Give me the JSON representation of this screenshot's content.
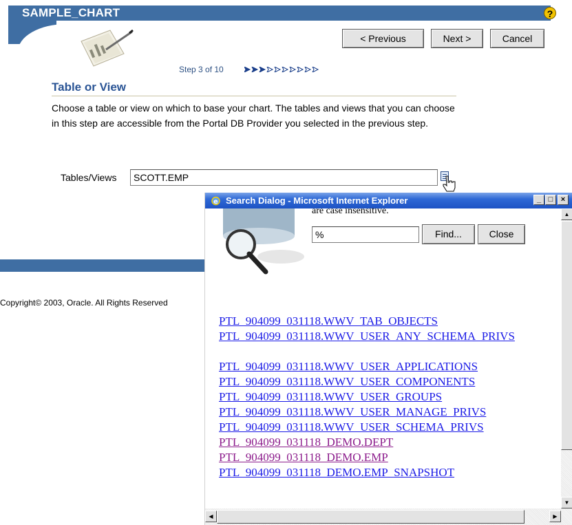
{
  "header": {
    "title": "SAMPLE_CHART",
    "help_icon": "?"
  },
  "toolbar": {
    "previous_label": "< Previous",
    "next_label": "Next >",
    "cancel_label": "Cancel"
  },
  "wizard": {
    "step_text": "Step 3 of 10",
    "current_step": 3,
    "total_steps": 10
  },
  "section": {
    "title": "Table or View",
    "description": "Choose a table or view on which to base your chart. The tables and views that you can choose in this step are accessible from the Portal DB Provider you selected in the previous step."
  },
  "form": {
    "tables_views_label": "Tables/Views",
    "tables_views_value": "SCOTT.EMP"
  },
  "footer": {
    "copyright": "Copyright© 2003, Oracle. All Rights Reserved"
  },
  "popup": {
    "title": "Search Dialog - Microsoft Internet Explorer",
    "window_buttons": {
      "minimize": "_",
      "maximize": "□",
      "close": "×"
    },
    "case_text": "are case insensitive.",
    "search_value": "%",
    "find_label": "Find...",
    "close_label": "Close",
    "results": [
      {
        "text": "PTL_904099_031118.WWV_TAB_OBJECTS",
        "visited": false
      },
      {
        "text": "PTL_904099_031118.WWV_USER_ANY_SCHEMA_PRIVS",
        "visited": false
      },
      {
        "text": "",
        "visited": false
      },
      {
        "text": "PTL_904099_031118.WWV_USER_APPLICATIONS",
        "visited": false
      },
      {
        "text": "PTL_904099_031118.WWV_USER_COMPONENTS",
        "visited": false
      },
      {
        "text": "PTL_904099_031118.WWV_USER_GROUPS",
        "visited": false
      },
      {
        "text": "PTL_904099_031118.WWV_USER_MANAGE_PRIVS",
        "visited": false
      },
      {
        "text": "PTL_904099_031118.WWV_USER_SCHEMA_PRIVS",
        "visited": false
      },
      {
        "text": "PTL_904099_031118_DEMO.DEPT",
        "visited": true
      },
      {
        "text": "PTL_904099_031118_DEMO.EMP",
        "visited": true
      },
      {
        "text": "PTL_904099_031118_DEMO.EMP_SNAPSHOT",
        "visited": false
      }
    ]
  },
  "colors": {
    "header_blue": "#3f6ea3",
    "link": "#1a1ae6",
    "visited_link": "#8b1a8b",
    "title_blue": "#2a5495"
  },
  "icons": [
    "help-icon",
    "chart-wizard-icon",
    "step-progress-icon",
    "list-of-values-icon",
    "hand-cursor-icon",
    "ie-icon",
    "database-magnifier-icon"
  ]
}
